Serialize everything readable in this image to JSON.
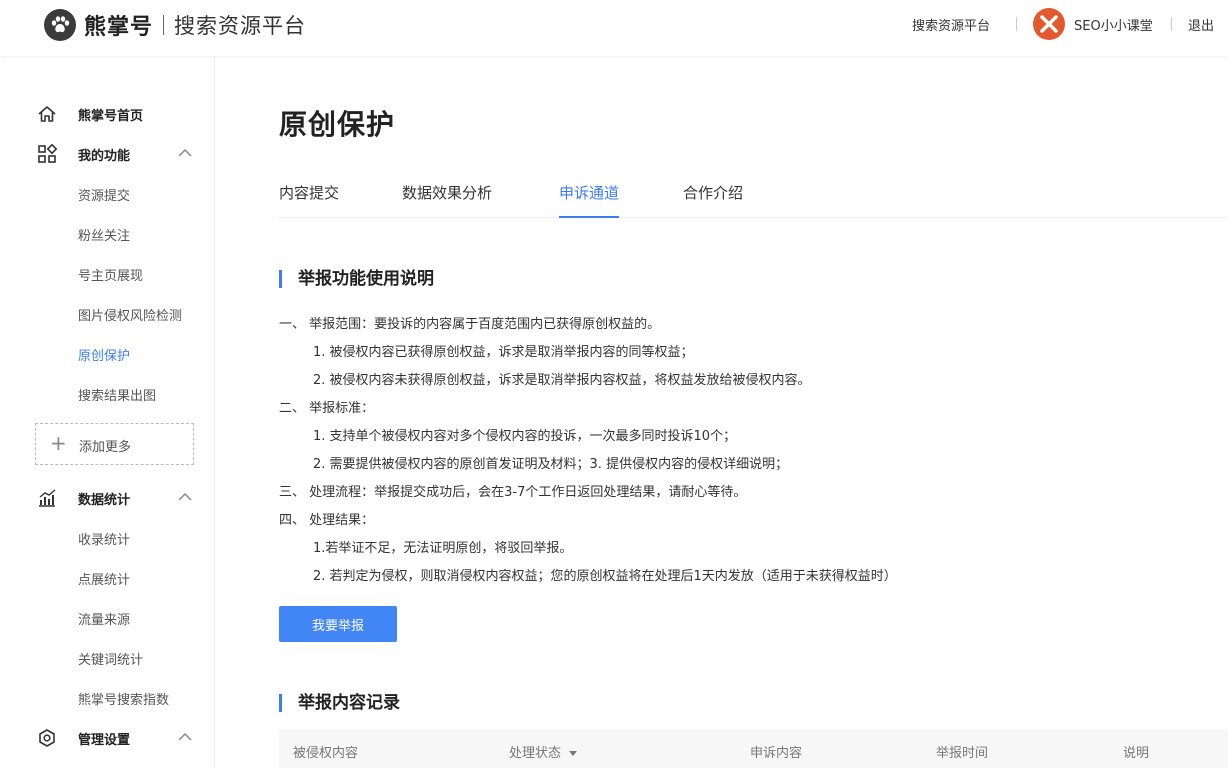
{
  "header": {
    "brand": "熊掌号",
    "subtitle": "搜索资源平台",
    "nav_link": "搜索资源平台",
    "username": "SEO小小课堂",
    "logout": "退出"
  },
  "sidebar": {
    "home": "熊掌号首页",
    "my_functions": "我的功能",
    "functions_items": [
      "资源提交",
      "粉丝关注",
      "号主页展现",
      "图片侵权风险检测",
      "原创保护",
      "搜索结果出图"
    ],
    "add_more": "添加更多",
    "data_stats": "数据统计",
    "stats_items": [
      "收录统计",
      "点展统计",
      "流量来源",
      "关键词统计",
      "熊掌号搜索指数"
    ],
    "settings": "管理设置"
  },
  "main": {
    "title": "原创保护",
    "tabs": [
      "内容提交",
      "数据效果分析",
      "申诉通道",
      "合作介绍"
    ],
    "section1_title": "举报功能使用说明",
    "instructions": [
      "一、 举报范围：要投诉的内容属于百度范围内已获得原创权益的。",
      "1. 被侵权内容已获得原创权益，诉求是取消举报内容的同等权益；",
      "2. 被侵权内容未获得原创权益，诉求是取消举报内容权益，将权益发放给被侵权内容。",
      "二、 举报标准：",
      "1. 支持单个被侵权内容对多个侵权内容的投诉，一次最多同时投诉10个；",
      "2. 需要提供被侵权内容的原创首发证明及材料；3. 提供侵权内容的侵权详细说明；",
      "三、 处理流程：举报提交成功后，会在3-7个工作日返回处理结果，请耐心等待。",
      "四、 处理结果：",
      "1.若举证不足，无法证明原创，将驳回举报。",
      "2. 若判定为侵权，则取消侵权内容权益；您的原创权益将在处理后1天内发放（适用于未获得权益时）"
    ],
    "report_button": "我要举报",
    "section2_title": "举报内容记录",
    "table_headers": [
      "被侵权内容",
      "处理状态",
      "申诉内容",
      "举报时间",
      "说明"
    ]
  },
  "colors": {
    "accent": "#3d7cf5",
    "button": "#4285f4",
    "avatar": "#e5582e"
  }
}
